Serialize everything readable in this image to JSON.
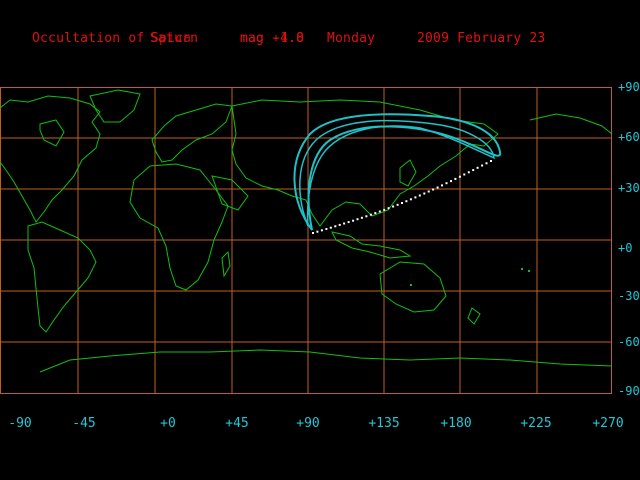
{
  "header": {
    "prefix": "Occultation of",
    "object_a": "Saturn",
    "object_b": "Spica",
    "mag_a": "mag -4.8",
    "mag_b": "mag +1.0",
    "weekday": "Monday",
    "date": "2009 February 23"
  },
  "colors": {
    "title": "#e01010",
    "grid": "#c06020",
    "coast": "#10c010",
    "labels": "#20c8d8",
    "track": "#20c0c8",
    "dots": "#ffffff"
  },
  "axes": {
    "lat_labels": [
      "+90",
      "+60",
      "+30",
      "+0",
      "-30",
      "-60",
      "-90"
    ],
    "lon_labels": [
      "-90",
      "-45",
      "+0",
      "+45",
      "+90",
      "+135",
      "+180",
      "+225",
      "+270"
    ]
  }
}
